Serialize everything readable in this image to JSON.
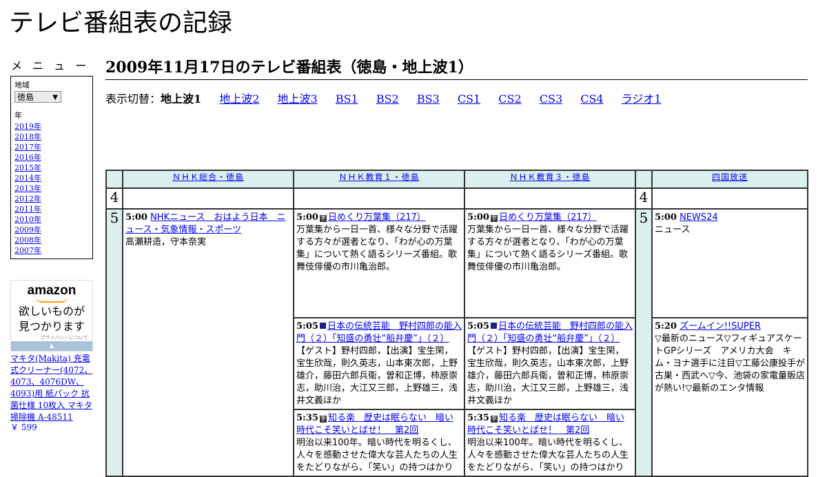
{
  "site_title": "テレビ番組表の記録",
  "sidebar": {
    "menu_heading": "メ ニ ュ ー",
    "region_label": "地域",
    "region_value": "徳島",
    "year_label": "年",
    "years": [
      "2019年",
      "2018年",
      "2017年",
      "2016年",
      "2015年",
      "2014年",
      "2013年",
      "2012年",
      "2011年",
      "2010年",
      "2009年",
      "2008年",
      "2007年"
    ]
  },
  "ad": {
    "logo": "amazon",
    "tagline_1": "欲しいものが",
    "tagline_2": "見つかります",
    "privacy": "プライバシーについて",
    "product": "マキタ(Makita) 充電式クリーナー(4072、4073、4076DW、4093)用 紙パック 抗菌仕様 10枚入 マキタ 掃除機 A-48511",
    "price": "￥ 599"
  },
  "heading": "2009年11月17日のテレビ番組表（徳島・地上波1）",
  "switch": {
    "label": "表示切替：",
    "current": "地上波1",
    "links": [
      "地上波2",
      "地上波3",
      "BS1",
      "BS2",
      "BS3",
      "CS1",
      "CS2",
      "CS3",
      "CS4",
      "ラジオ1"
    ]
  },
  "channels": [
    "ＮＨＫ総合・徳島",
    "ＮＨＫ教育１・徳島",
    "ＮＨＫ教育３・徳島",
    "四国放送"
  ],
  "hours": {
    "h4": "4",
    "h5": "5"
  },
  "programs": {
    "nhk_sogo": {
      "p1": {
        "time": "5:00",
        "title": "NHKニュース　おはよう日本　ニュース・気象情報・スポーツ",
        "desc": "高瀬耕造，守本奈実"
      }
    },
    "nhk_edu1": {
      "p1": {
        "time": "5:00",
        "title": "日めくり万葉集（217）",
        "desc": "万葉集から一日一首、様々な分野で活躍する方々が選者となり、「わが心の万葉集」について熱く語るシリーズ番組。歌舞伎俳優の市川亀治郎。"
      },
      "p2": {
        "time": "5:05",
        "title": "日本の伝統芸能　野村四郎の能入門（２）「知盛の勇壮“船弁慶”」（２）",
        "desc": "【ゲスト】野村四郎，【出演】宝生閑，宝生欣哉，則久英志，山本東次郎，上野雄介，藤田六郎兵衛，曽和正博，柿原崇志，助川治，大江又三郎，上野雄三，浅井文義ほか"
      },
      "p3": {
        "time": "5:35",
        "title": "知る楽　歴史は眠らない　暗い時代こそ笑いとばせ！　第2回",
        "desc": "明治以来100年。暗い時代を明るくし、人々を感動させた偉大な芸人たちの人生をたどりながら、「笑い」の持つはかり"
      }
    },
    "nhk_edu3": {
      "p1": {
        "time": "5:00",
        "title": "日めくり万葉集（217）",
        "desc": "万葉集から一日一首、様々な分野で活躍する方々が選者となり、「わが心の万葉集」について熱く語るシリーズ番組。歌舞伎俳優の市川亀治郎。"
      },
      "p2": {
        "time": "5:05",
        "title": "日本の伝統芸能　野村四郎の能入門（２）「知盛の勇壮“船弁慶”」（２）",
        "desc": "【ゲスト】野村四郎，【出演】宝生閑，宝生欣哉，則久英志，山本東次郎，上野雄介，藤田六郎兵衛，曽和正博，柿原崇志，助川治，大江又三郎，上野雄三，浅井文義ほか"
      },
      "p3": {
        "time": "5:35",
        "title": "知る楽　歴史は眠らない　暗い時代こそ笑いとばせ！　第2回",
        "desc": "明治以来100年。暗い時代を明るくし、人々を感動させた偉大な芸人たちの人生をたどりながら、「笑い」の持つはかり"
      }
    },
    "shikoku": {
      "p1": {
        "time": "5:00",
        "title": "NEWS24",
        "desc": "ニュース"
      },
      "p2": {
        "time": "5:20",
        "title": "ズームイン!!SUPER",
        "desc": "▽最新のニュース▽フィギュアスケートGPシリーズ　アメリカ大会　キム・ヨナ選手に注目▽工藤公康投手が古巣・西武へ▽今、池袋の家電量販店が熱い!▽最新のエンタ情報"
      }
    }
  }
}
